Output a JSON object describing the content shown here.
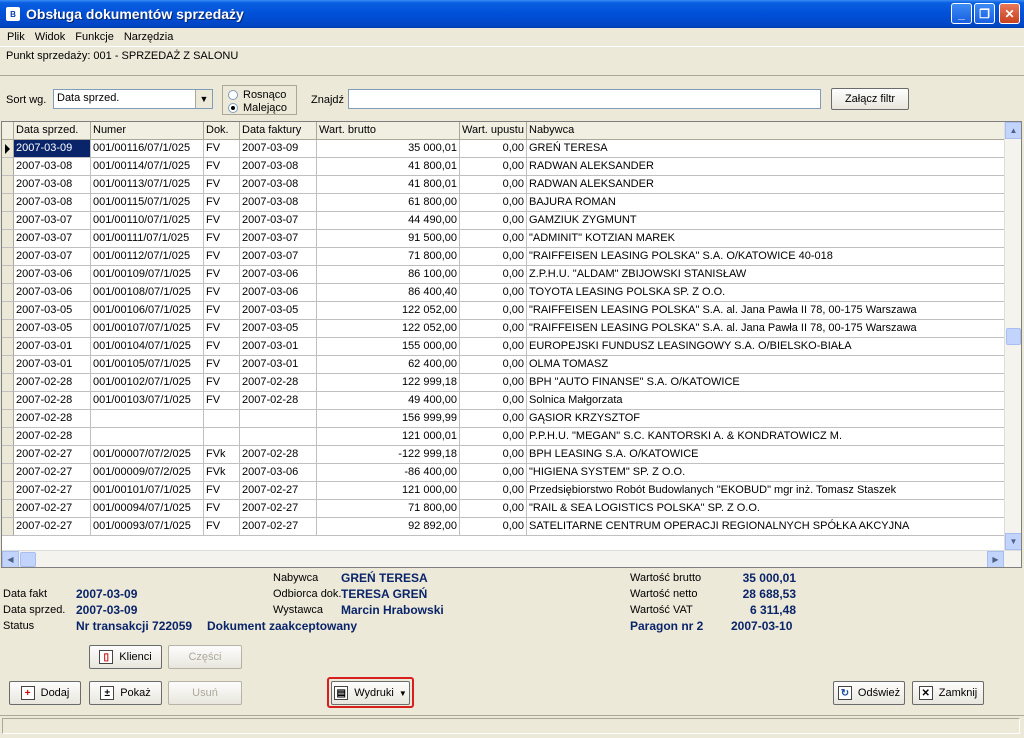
{
  "window": {
    "title": "Obsługa dokumentów sprzedaży",
    "minimize": "_",
    "restore": "❐",
    "close": "✕"
  },
  "menu": [
    "Plik",
    "Widok",
    "Funkcje",
    "Narzędzia"
  ],
  "info": {
    "point_of_sale": "Punkt sprzedaży: 001 - SPRZEDAŻ Z SALONU"
  },
  "sortbar": {
    "sort_label": "Sort wg.",
    "sort_value": "Data sprzed.",
    "radio_asc": "Rosnąco",
    "radio_desc": "Malejąco",
    "selected": "desc",
    "find_label": "Znajdź",
    "find_value": "",
    "filter_button": "Załącz filtr"
  },
  "grid": {
    "columns": [
      {
        "key": "data_sprzed",
        "label": "Data sprzed."
      },
      {
        "key": "numer",
        "label": "Numer"
      },
      {
        "key": "dok",
        "label": "Dok."
      },
      {
        "key": "data_faktury",
        "label": "Data faktury"
      },
      {
        "key": "wart_brutto",
        "label": "Wart. brutto"
      },
      {
        "key": "wart_upustu",
        "label": "Wart. upustu"
      },
      {
        "key": "nabywca",
        "label": "Nabywca"
      }
    ],
    "rows": [
      [
        "2007-03-09",
        "001/00116/07/1/025",
        "FV",
        "2007-03-09",
        "35 000,01",
        "0,00",
        "GREŃ TERESA"
      ],
      [
        "2007-03-08",
        "001/00114/07/1/025",
        "FV",
        "2007-03-08",
        "41 800,01",
        "0,00",
        "RADWAN ALEKSANDER"
      ],
      [
        "2007-03-08",
        "001/00113/07/1/025",
        "FV",
        "2007-03-08",
        "41 800,01",
        "0,00",
        "RADWAN ALEKSANDER"
      ],
      [
        "2007-03-08",
        "001/00115/07/1/025",
        "FV",
        "2007-03-08",
        "61 800,00",
        "0,00",
        "BAJURA ROMAN"
      ],
      [
        "2007-03-07",
        "001/00110/07/1/025",
        "FV",
        "2007-03-07",
        "44 490,00",
        "0,00",
        "GAMZIUK ZYGMUNT"
      ],
      [
        "2007-03-07",
        "001/00111/07/1/025",
        "FV",
        "2007-03-07",
        "91 500,00",
        "0,00",
        "\"ADMINIT\" KOTZIAN MAREK"
      ],
      [
        "2007-03-07",
        "001/00112/07/1/025",
        "FV",
        "2007-03-07",
        "71 800,00",
        "0,00",
        "\"RAIFFEISEN LEASING POLSKA\" S.A. O/KATOWICE 40-018"
      ],
      [
        "2007-03-06",
        "001/00109/07/1/025",
        "FV",
        "2007-03-06",
        "86 100,00",
        "0,00",
        "Z.P.H.U. \"ALDAM\" ZBIJOWSKI STANISŁAW"
      ],
      [
        "2007-03-06",
        "001/00108/07/1/025",
        "FV",
        "2007-03-06",
        "86 400,40",
        "0,00",
        "TOYOTA LEASING POLSKA  SP. Z O.O."
      ],
      [
        "2007-03-05",
        "001/00106/07/1/025",
        "FV",
        "2007-03-05",
        "122 052,00",
        "0,00",
        "\"RAIFFEISEN LEASING POLSKA\" S.A. al. Jana Pawła II 78, 00-175 Warszawa"
      ],
      [
        "2007-03-05",
        "001/00107/07/1/025",
        "FV",
        "2007-03-05",
        "122 052,00",
        "0,00",
        "\"RAIFFEISEN LEASING POLSKA\" S.A. al. Jana Pawła II 78, 00-175 Warszawa"
      ],
      [
        "2007-03-01",
        "001/00104/07/1/025",
        "FV",
        "2007-03-01",
        "155 000,00",
        "0,00",
        "EUROPEJSKI FUNDUSZ LEASINGOWY S.A. O/BIELSKO-BIAŁA"
      ],
      [
        "2007-03-01",
        "001/00105/07/1/025",
        "FV",
        "2007-03-01",
        "62 400,00",
        "0,00",
        "OLMA TOMASZ"
      ],
      [
        "2007-02-28",
        "001/00102/07/1/025",
        "FV",
        "2007-02-28",
        "122 999,18",
        "0,00",
        "BPH \"AUTO FINANSE\" S.A. O/KATOWICE"
      ],
      [
        "2007-02-28",
        "001/00103/07/1/025",
        "FV",
        "2007-02-28",
        "49 400,00",
        "0,00",
        "Solnica Małgorzata"
      ],
      [
        "2007-02-28",
        "",
        "",
        "",
        "156 999,99",
        "0,00",
        "GĄSIOR KRZYSZTOF"
      ],
      [
        "2007-02-28",
        "",
        "",
        "",
        "121 000,01",
        "0,00",
        "P.P.H.U. \"MEGAN\" S.C. KANTORSKI A. & KONDRATOWICZ M."
      ],
      [
        "2007-02-27",
        "001/00007/07/2/025",
        "FVk",
        "2007-02-28",
        "-122 999,18",
        "0,00",
        "BPH LEASING S.A. O/KATOWICE"
      ],
      [
        "2007-02-27",
        "001/00009/07/2/025",
        "FVk",
        "2007-03-06",
        "-86 400,00",
        "0,00",
        "\"HIGIENA SYSTEM\" SP. Z O.O."
      ],
      [
        "2007-02-27",
        "001/00101/07/1/025",
        "FV",
        "2007-02-27",
        "121 000,00",
        "0,00",
        "Przedsiębiorstwo Robót Budowlanych \"EKOBUD\"  mgr inż. Tomasz Staszek"
      ],
      [
        "2007-02-27",
        "001/00094/07/1/025",
        "FV",
        "2007-02-27",
        "71 800,00",
        "0,00",
        "\"RAIL & SEA LOGISTICS POLSKA\" SP. Z O.O."
      ],
      [
        "2007-02-27",
        "001/00093/07/1/025",
        "FV",
        "2007-02-27",
        "92 892,00",
        "0,00",
        "SATELITARNE CENTRUM OPERACJI REGIONALNYCH SPÓŁKA AKCYJNA"
      ]
    ]
  },
  "details": {
    "data_fakt_label": "Data fakt",
    "data_fakt": "2007-03-09",
    "data_sprzed_label": "Data sprzed.",
    "data_sprzed": "2007-03-09",
    "status_label": "Status",
    "transakcja": "Nr transakcji 722059",
    "dokument_status": "Dokument zaakceptowany",
    "nabywca_label": "Nabywca",
    "nabywca": "GREŃ TERESA",
    "odbiorca_label": "Odbiorca dok.",
    "odbiorca": "TERESA GREŃ",
    "wystawca_label": "Wystawca",
    "wystawca": "Marcin Hrabowski",
    "brutto_label": "Wartość brutto",
    "brutto": "35 000,01",
    "netto_label": "Wartość netto",
    "netto": "28 688,53",
    "vat_label": "Wartość VAT",
    "vat": "6 311,48",
    "paragon": "Paragon nr 2",
    "paragon_date": "2007-03-10"
  },
  "buttons": {
    "klienci": "Klienci",
    "czesci": "Części",
    "dodaj": "Dodaj",
    "pokaz": "Pokaż",
    "usun": "Usuń",
    "wydruki": "Wydruki",
    "odswiez": "Odśwież",
    "zamknij": "Zamknij"
  },
  "accent_colors": {
    "titlebar": "#0050d8",
    "selection": "#0a246a",
    "value_text": "#0a246a",
    "highlight": "#d81e1e"
  }
}
